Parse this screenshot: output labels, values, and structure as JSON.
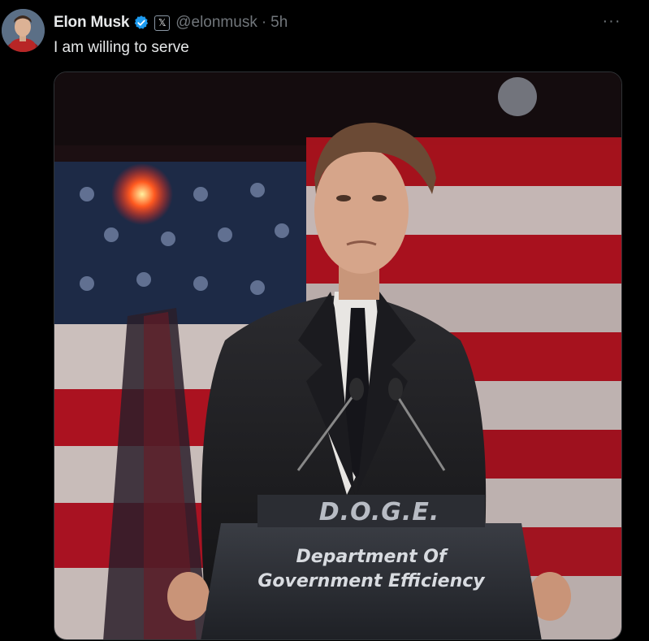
{
  "post": {
    "author_name": "Elon Musk",
    "handle": "@elonmusk",
    "separator": "·",
    "time": "5h",
    "text": "I am willing to serve",
    "more_label": "···",
    "x_badge_label": "𝕏",
    "icons": {
      "verified": "verified-badge-icon",
      "affiliation": "x-logo-icon",
      "more": "more-options-icon"
    }
  },
  "media": {
    "sign_title": "D.O.G.E.",
    "sign_line_1": "Department Of",
    "sign_line_2": "Government Efficiency"
  },
  "colors": {
    "background": "#000000",
    "primary_text": "#e7e9ea",
    "secondary_text": "#71767b",
    "verified_blue": "#1d9bf0"
  }
}
